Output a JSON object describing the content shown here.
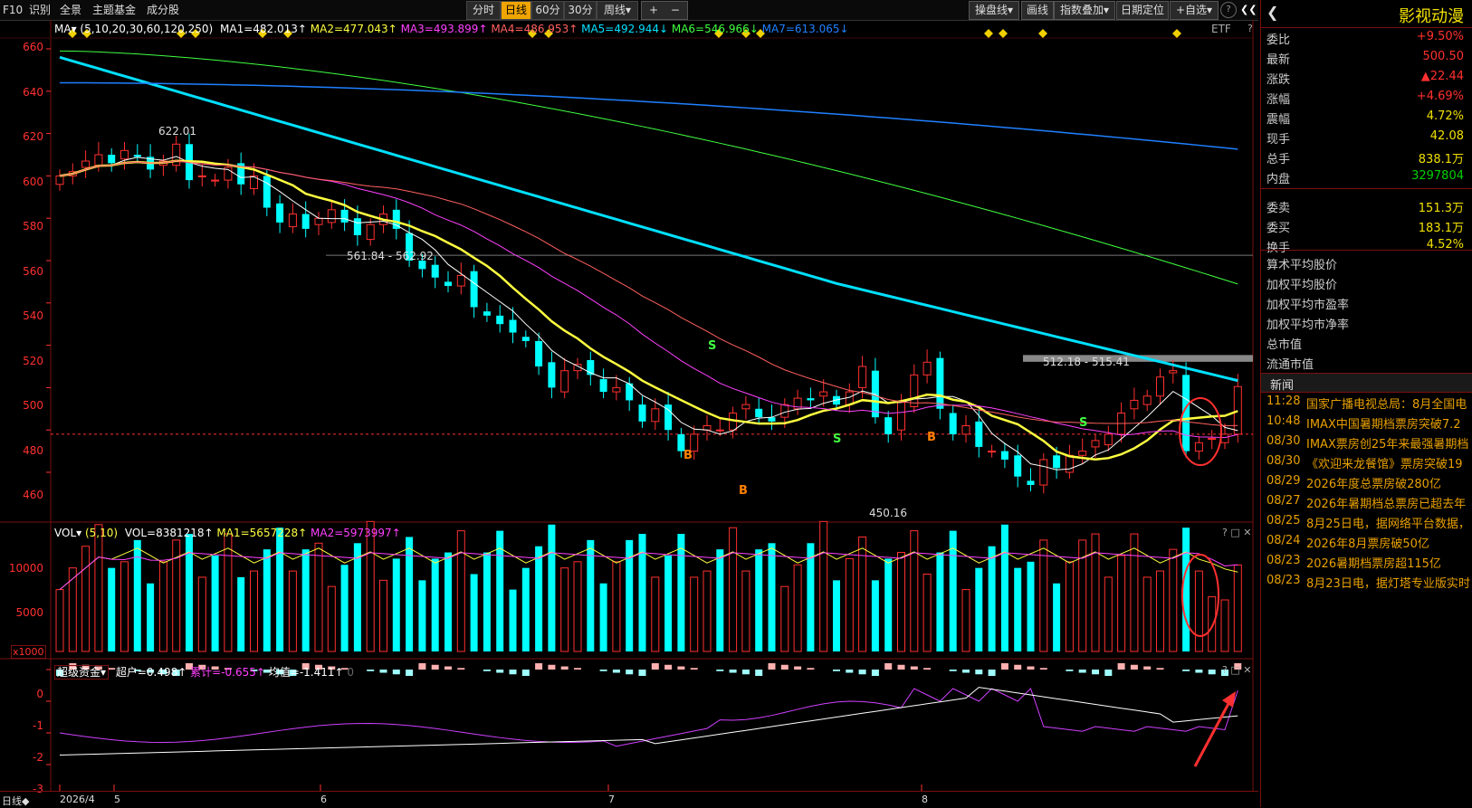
{
  "topbar": {
    "items_left": [
      "F10",
      "识别",
      "全景",
      "主题基金",
      "成分股"
    ],
    "periods": [
      "分时",
      "日线",
      "60分",
      "30分",
      "周线▾"
    ],
    "active_period": "日线",
    "zoom_in": "+",
    "zoom_out": "−",
    "right_items": [
      "操盘线▾",
      "画线",
      "指数叠加▾",
      "日期定位",
      "+自选▾"
    ],
    "help": "?",
    "collapse": "❮❮"
  },
  "stock": {
    "name": "影视动漫",
    "back": "❮"
  },
  "quote": [
    {
      "label": "委比",
      "value": "+9.50%",
      "color": "red"
    },
    {
      "label": "最新",
      "value": "500.50",
      "color": "red"
    },
    {
      "label": "涨跌",
      "value": "▲22.44",
      "color": "red"
    },
    {
      "label": "涨幅",
      "value": "+4.69%",
      "color": "red"
    },
    {
      "label": "震幅",
      "value": "4.72%",
      "color": "yellow"
    },
    {
      "label": "现手",
      "value": "42.08",
      "color": "yellow"
    },
    {
      "label": "总手",
      "value": "838.1万",
      "color": "yellow"
    },
    {
      "label": "内盘",
      "value": "3297804",
      "color": "green"
    },
    {
      "label": "委卖",
      "value": "151.3万",
      "color": "yellow"
    },
    {
      "label": "委买",
      "value": "183.1万",
      "color": "yellow"
    },
    {
      "label": "换手",
      "value": "4.52%",
      "color": "yellow"
    }
  ],
  "stats_labels": [
    "算术平均股价",
    "加权平均股价",
    "加权平均市盈率",
    "加权平均市净率",
    "总市值",
    "流通市值"
  ],
  "news_title": "新闻",
  "news": [
    {
      "time": "11:28",
      "text": "国家广播电视总局：8月全国电"
    },
    {
      "time": "10:48",
      "text": "IMAX中国暑期档票房突破7.2"
    },
    {
      "time": "08/30",
      "text": "IMAX票房创25年来最强暑期档"
    },
    {
      "time": "08/30",
      "text": "《欢迎来龙餐馆》票房突破19"
    },
    {
      "time": "08/29",
      "text": "2026年度总票房破280亿"
    },
    {
      "time": "08/27",
      "text": "2026年暑期档总票房已超去年"
    },
    {
      "time": "08/25",
      "text": "8月25日电，据网络平台数据，"
    },
    {
      "time": "08/24",
      "text": "2026年8月票房破50亿"
    },
    {
      "time": "08/23",
      "text": "2026暑期档票房超115亿"
    },
    {
      "time": "08/23",
      "text": "8月23日电，据灯塔专业版实时"
    }
  ],
  "main_pane": {
    "header": {
      "ma_tag": "MA▾",
      "params": "(5,10,20,30,60,120,250)",
      "ma1": "MA1=482.013↑",
      "ma2": "MA2=477.043↑",
      "ma3": "MA3=493.899↑",
      "ma4": "MA4=486.953↑",
      "ma5": "MA5=492.944↓",
      "ma6": "MA6=546.966↓",
      "ma7": "MA7=613.065↓"
    },
    "etf": "ETF",
    "y_labels": [
      "660",
      "640",
      "620",
      "600",
      "580",
      "560",
      "540",
      "520",
      "500",
      "480",
      "460"
    ],
    "annotations": {
      "high": "622.01",
      "gap1": "561.84 - 562.92",
      "gap2": "512.18 - 515.41",
      "low": "450.16"
    },
    "signals": [
      "S",
      "S",
      "S",
      "B",
      "B",
      "B"
    ]
  },
  "vol_pane": {
    "header": {
      "tag": "VOL▾",
      "params": "(5,10)",
      "vol": "VOL=8381218↑",
      "ma1": "MA1=5657228↑",
      "ma2": "MA2=5973997↑"
    },
    "y_labels": [
      "10000",
      "5000"
    ],
    "unit": "x1000"
  },
  "fund_pane": {
    "header": {
      "tag": "超级资金▾",
      "v1": "超户=0.498↑",
      "v2": "累计=-0.655↑",
      "v3": "均值=-1.411↑",
      "v4": "0"
    },
    "y_labels": [
      "0",
      "-1",
      "-2",
      "-3"
    ]
  },
  "x_axis": {
    "mode": "日线◆",
    "labels": [
      "2026/4",
      "5",
      "6",
      "7",
      "8"
    ]
  },
  "pane_icons": "? □ ✕",
  "colors": {
    "up": "#ff3030",
    "down": "#00ffff",
    "ma5": "#ffffff",
    "ma10": "#ffff40",
    "ma20": "#ff40ff",
    "ma30": "#ff6060",
    "ma60": "#00e0ff",
    "ma120": "#40ff40",
    "ma250": "#2080ff"
  }
}
